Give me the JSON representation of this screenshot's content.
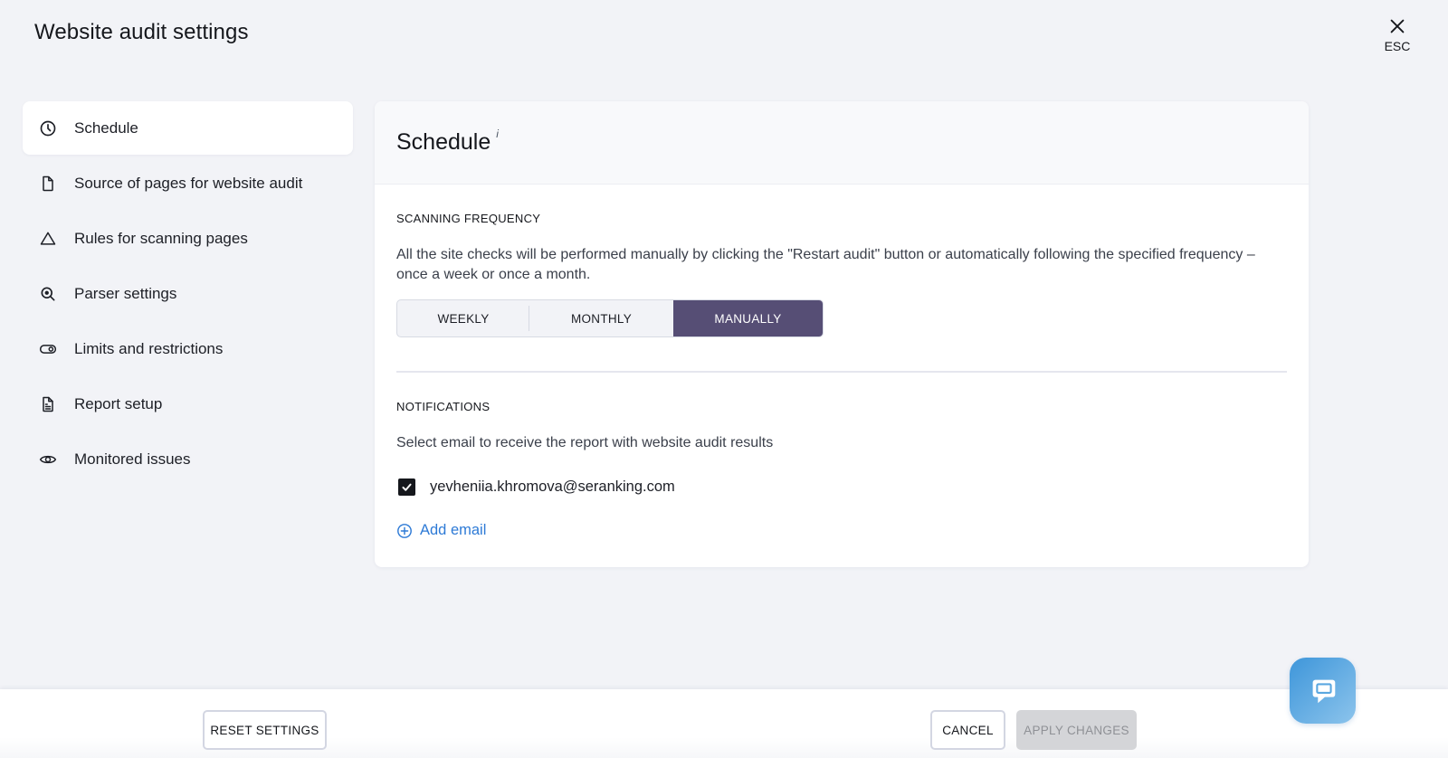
{
  "header": {
    "title": "Website audit settings",
    "close_label": "ESC"
  },
  "sidebar": {
    "items": [
      {
        "label": "Schedule",
        "icon": "clock-icon",
        "active": true
      },
      {
        "label": "Source of pages for website audit",
        "icon": "file-icon",
        "active": false
      },
      {
        "label": "Rules for scanning pages",
        "icon": "triangle-icon",
        "active": false
      },
      {
        "label": "Parser settings",
        "icon": "zoom-search-icon",
        "active": false
      },
      {
        "label": "Limits and restrictions",
        "icon": "toggle-icon",
        "active": false
      },
      {
        "label": "Report setup",
        "icon": "document-text-icon",
        "active": false
      },
      {
        "label": "Monitored issues",
        "icon": "eye-icon",
        "active": false
      }
    ]
  },
  "main": {
    "title": "Schedule",
    "info_mark": "i",
    "scanning": {
      "label": "SCANNING FREQUENCY",
      "description": "All the site checks will be performed manually by clicking the \"Restart audit\" button or automatically following the specified frequency – once a week or once a month.",
      "options": [
        "WEEKLY",
        "MONTHLY",
        "MANUALLY"
      ],
      "selected": "MANUALLY"
    },
    "notifications": {
      "label": "NOTIFICATIONS",
      "description": "Select email to receive the report with website audit results",
      "emails": [
        {
          "address": "yevheniia.khromova@seranking.com",
          "checked": true
        }
      ],
      "add_email_label": "Add email"
    }
  },
  "footer": {
    "reset_label": "RESET SETTINGS",
    "cancel_label": "CANCEL",
    "apply_label": "APPLY CHANGES",
    "apply_disabled": true
  },
  "colors": {
    "accent": "#564e75",
    "link": "#2d7ad6",
    "chat": "#3e96da"
  }
}
